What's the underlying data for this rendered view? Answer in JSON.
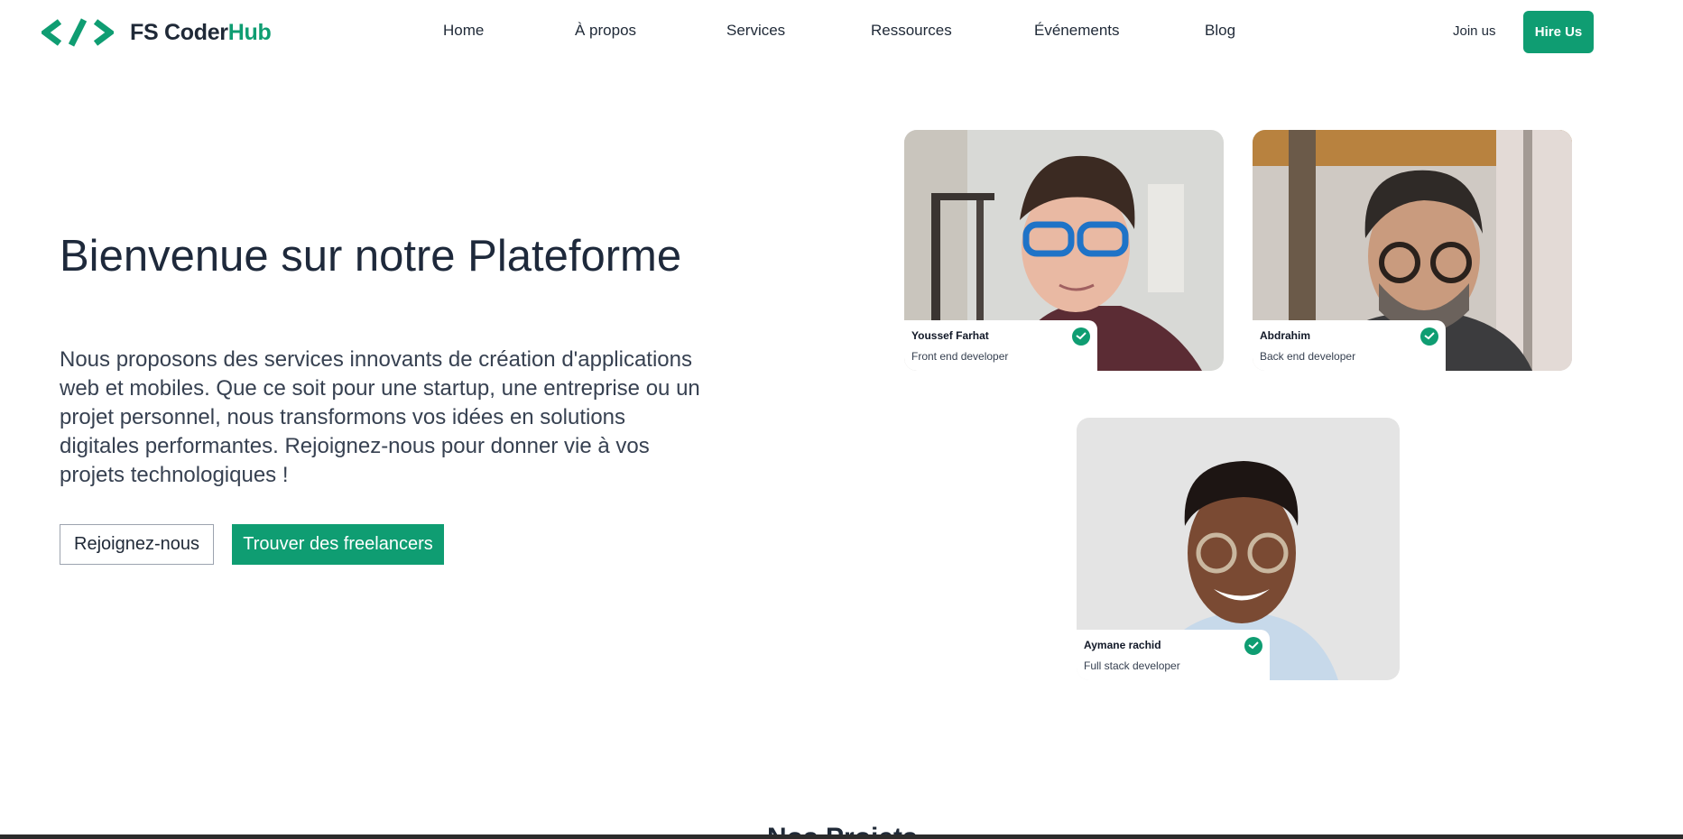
{
  "brand": {
    "name_part1": "FS Coder",
    "name_part2": "Hub",
    "accent_color": "#0f9d72",
    "icon": "code-brackets-icon"
  },
  "nav": {
    "items": [
      {
        "label": "Home"
      },
      {
        "label": "À propos"
      },
      {
        "label": "Services"
      },
      {
        "label": "Ressources"
      },
      {
        "label": "Événements"
      },
      {
        "label": "Blog"
      }
    ],
    "join_label": "Join us",
    "hire_label": "Hire Us"
  },
  "hero": {
    "title": "Bienvenue sur notre Plateforme",
    "description": "Nous proposons des services innovants de création d'applications web et mobiles. Que ce soit pour une startup, une entreprise ou un projet personnel, nous transformons vos idées en solutions digitales performantes. Rejoignez-nous pour donner vie à vos projets technologiques !",
    "btn_secondary": "Rejoignez-nous",
    "btn_primary": "Trouver des freelancers"
  },
  "profiles": [
    {
      "name": "Youssef Farhat",
      "role": "Front end developer",
      "verified_icon": "check-badge-icon"
    },
    {
      "name": "Abdrahim",
      "role": "Back end developer",
      "verified_icon": "check-badge-icon"
    },
    {
      "name": "Aymane rachid",
      "role": "Full stack developer",
      "verified_icon": "check-badge-icon"
    }
  ],
  "next_section": {
    "title": "Nos Projets"
  }
}
